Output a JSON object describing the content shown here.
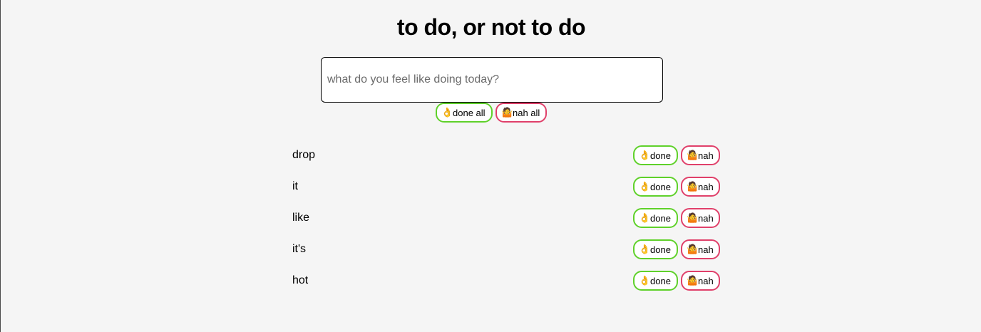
{
  "header": {
    "title": "to do, or not to do"
  },
  "input": {
    "placeholder": "what do you feel like doing today?",
    "value": ""
  },
  "bulk_actions": {
    "done_all": {
      "emoji": "👌",
      "label": "done all"
    },
    "nah_all": {
      "emoji": "🤷",
      "label": "nah all"
    }
  },
  "todos": [
    {
      "text": "drop",
      "done": {
        "emoji": "👌",
        "label": "done"
      },
      "nah": {
        "emoji": "🤷",
        "label": "nah"
      }
    },
    {
      "text": "it",
      "done": {
        "emoji": "👌",
        "label": "done"
      },
      "nah": {
        "emoji": "🤷",
        "label": "nah"
      }
    },
    {
      "text": "like",
      "done": {
        "emoji": "👌",
        "label": "done"
      },
      "nah": {
        "emoji": "🤷",
        "label": "nah"
      }
    },
    {
      "text": "it's",
      "done": {
        "emoji": "👌",
        "label": "done"
      },
      "nah": {
        "emoji": "🤷",
        "label": "nah"
      }
    },
    {
      "text": "hot",
      "done": {
        "emoji": "👌",
        "label": "done"
      },
      "nah": {
        "emoji": "🤷",
        "label": "nah"
      }
    }
  ],
  "colors": {
    "done_border": "#5fd12a",
    "nah_border": "#e0406a",
    "background": "#f5f5f5"
  }
}
